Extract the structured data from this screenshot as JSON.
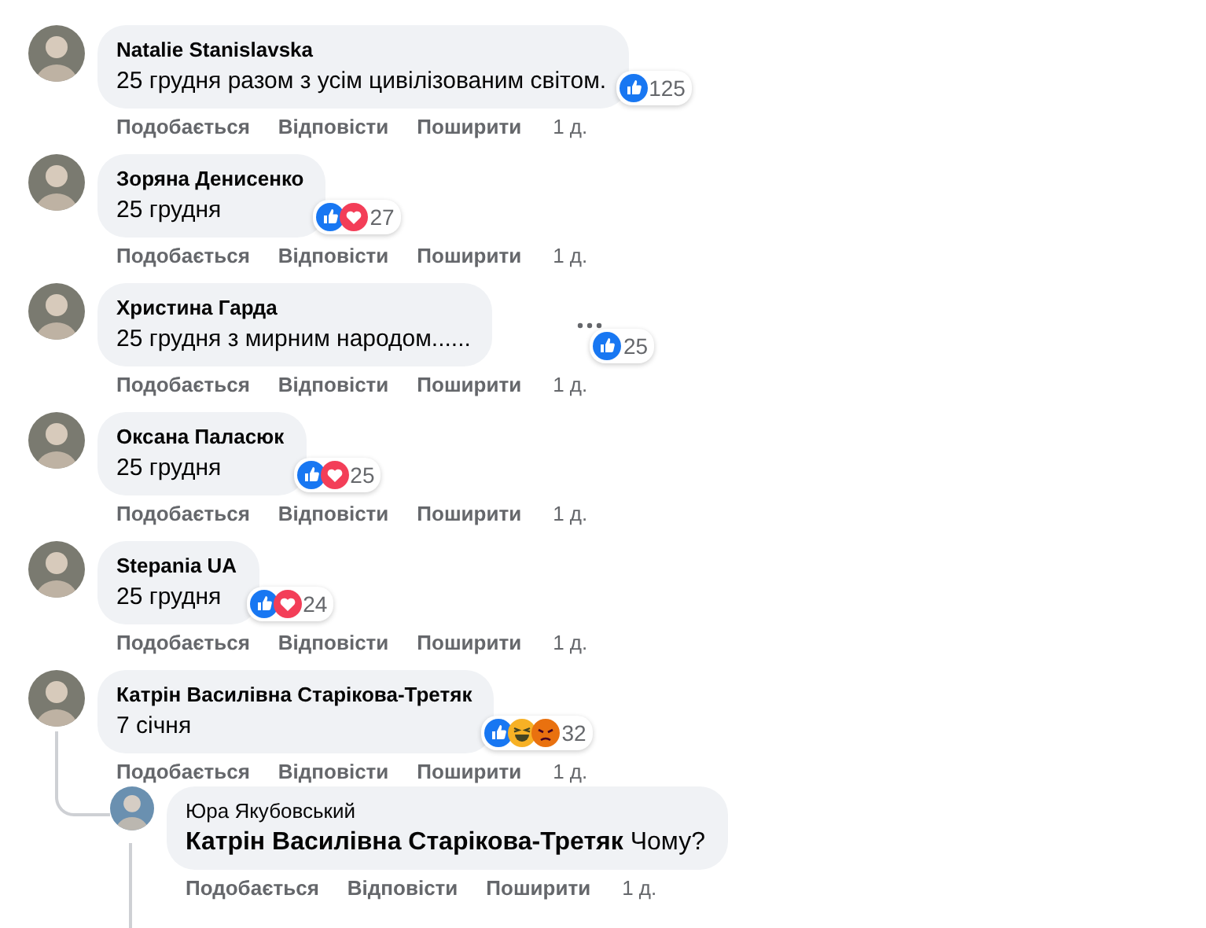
{
  "comments": [
    {
      "author": "Natalie Stanislavska",
      "text": "25 грудня разом з усім цивілізованим світом.",
      "reactions": [
        {
          "kind": "like"
        }
      ],
      "reaction_count": "125",
      "actions": [
        "Подобається",
        "Відповісти",
        "Поширити"
      ],
      "time": "1 д.",
      "show_options": false
    },
    {
      "author": "Зоряна Денисенко",
      "text": "25 грудня",
      "reactions": [
        {
          "kind": "like"
        },
        {
          "kind": "love"
        }
      ],
      "reaction_count": "27",
      "actions": [
        "Подобається",
        "Відповісти",
        "Поширити"
      ],
      "time": "1 д.",
      "show_options": false
    },
    {
      "author": "Христина Гарда",
      "text": "25 грудня з мирним народом......",
      "reactions": [
        {
          "kind": "like"
        }
      ],
      "reaction_count": "25",
      "actions": [
        "Подобається",
        "Відповісти",
        "Поширити"
      ],
      "time": "1 д.",
      "show_options": true
    },
    {
      "author": "Оксана Паласюк",
      "text": "25 грудня",
      "reactions": [
        {
          "kind": "like"
        },
        {
          "kind": "love"
        }
      ],
      "reaction_count": "25",
      "actions": [
        "Подобається",
        "Відповісти",
        "Поширити"
      ],
      "time": "1 д.",
      "show_options": false
    },
    {
      "author": "Stepania UA",
      "text": "25 грудня",
      "reactions": [
        {
          "kind": "like"
        },
        {
          "kind": "love"
        }
      ],
      "reaction_count": "24",
      "actions": [
        "Подобається",
        "Відповісти",
        "Поширити"
      ],
      "time": "1 д.",
      "show_options": false
    },
    {
      "author": "Катрін Василівна Старікова-Третяк",
      "text": "7 січня",
      "reactions": [
        {
          "kind": "like"
        },
        {
          "kind": "haha"
        },
        {
          "kind": "angry"
        }
      ],
      "reaction_count": "32",
      "actions": [
        "Подобається",
        "Відповісти",
        "Поширити"
      ],
      "time": "1 д.",
      "show_options": false,
      "replies": [
        {
          "author": "Юра Якубовський",
          "text": "**Катрін Василівна Старікова-Третяк** Чому?",
          "actions": [
            "Подобається",
            "Відповісти",
            "Поширити"
          ],
          "time": "1 д.",
          "show_options": false
        }
      ]
    }
  ]
}
